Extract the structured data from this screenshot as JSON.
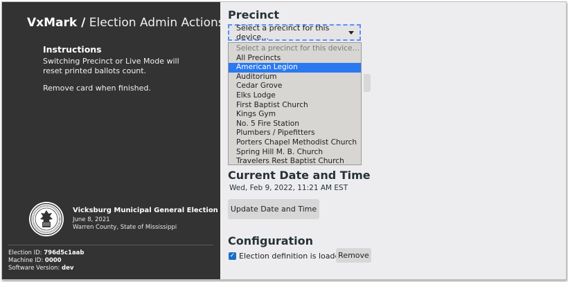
{
  "sidebar": {
    "brand": "VxMark /",
    "subtitle": "Election Admin Actions",
    "instructions_heading": "Instructions",
    "instructions_lines": [
      "Switching Precinct or Live Mode will",
      "reset printed ballots count.",
      "Remove card when finished."
    ],
    "election": {
      "title": "Vicksburg Municipal General Election",
      "date": "June 8, 2021",
      "location": "Warren County, State of Mississippi"
    },
    "meta": {
      "election_id_label": "Election ID:",
      "election_id": "796d5c1aab",
      "machine_id_label": "Machine ID:",
      "machine_id": "0000",
      "software_version_label": "Software Version:",
      "software_version": "dev"
    }
  },
  "main": {
    "precinct_heading": "Precinct",
    "precinct_select": {
      "value": "Select a precinct for this device…",
      "options": [
        "Select a precinct for this device…",
        "All Precincts",
        "American Legion",
        "Auditorium",
        "Cedar Grove",
        "Elks Lodge",
        "First Baptist Church",
        "Kings Gym",
        "No. 5 Fire Station",
        "Plumbers / Pipefitters",
        "Porters Chapel Methodist Church",
        "Spring Hill M. B. Church",
        "Travelers Rest Baptist Church"
      ],
      "highlighted": "American Legion"
    },
    "datetime_heading": "Current Date and Time",
    "datetime_value": "Wed, Feb 9, 2022, 11:21 AM EST",
    "update_datetime_button": "Update Date and Time",
    "configuration_heading": "Configuration",
    "election_loaded_text": "Election definition is loaded.",
    "remove_button": "Remove"
  },
  "colors": {
    "sidebar_bg": "#333333",
    "main_bg": "#ededf0",
    "highlight": "#2a79f0",
    "focus_outline": "#5b8ff9",
    "checkbox": "#1a6fc4"
  }
}
